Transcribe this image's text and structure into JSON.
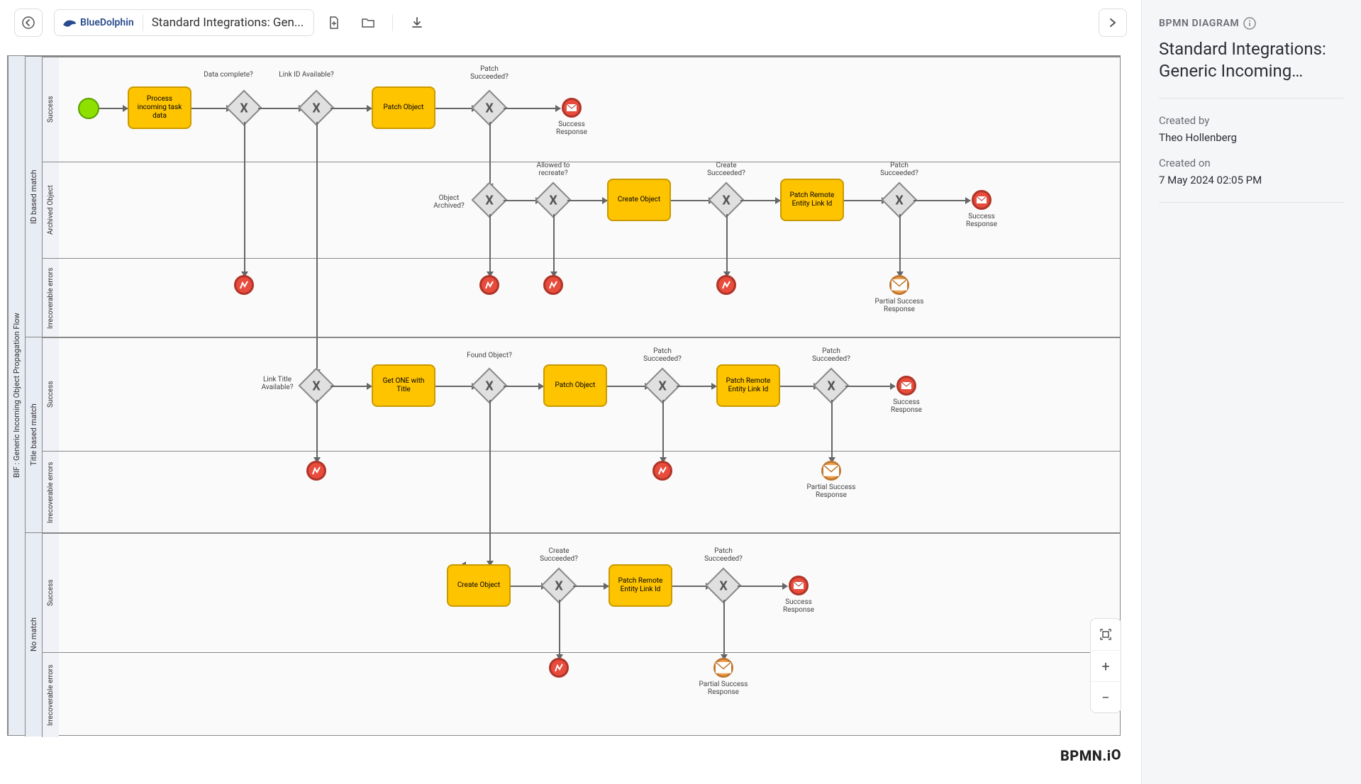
{
  "toolbar": {
    "brand": "BlueDolphin",
    "title": "Standard Integrations: Gen...",
    "icons": {
      "back": "back",
      "add_doc": "add-doc",
      "folder": "folder",
      "download": "download",
      "next": "next"
    }
  },
  "sidebar": {
    "heading": "BPMN DIAGRAM",
    "title": "Standard Integrations: Generic Incoming…",
    "created_by_label": "Created by",
    "created_by": "Theo Hollenberg",
    "created_on_label": "Created on",
    "created_on": "7 May 2024 02:05 PM"
  },
  "watermark": "BPMN.iO",
  "pool": {
    "name": "BIF : Generic Incoming Object Propagation Flow",
    "lanes": [
      {
        "name": "ID based match",
        "sublanes": [
          {
            "name": "Success"
          },
          {
            "name": "Archived Object"
          },
          {
            "name": "Irrecoverable errors"
          }
        ]
      },
      {
        "name": "Title based match",
        "sublanes": [
          {
            "name": "Success"
          },
          {
            "name": "Irrecoverable errors"
          }
        ]
      },
      {
        "name": "No match",
        "sublanes": [
          {
            "name": "Success"
          },
          {
            "name": "Irrecoverable errors"
          }
        ]
      }
    ]
  },
  "bpmn": {
    "tasks": {
      "process_incoming": "Process incoming task data",
      "patch_object": "Patch Object",
      "create_object": "Create Object",
      "patch_remote": "Patch Remote Entity Link Id",
      "get_one_title": "Get ONE with Title",
      "patch_object2": "Patch Object",
      "patch_remote2": "Patch Remote Entity Link Id",
      "create_object2": "Create Object",
      "patch_remote3": "Patch Remote Entity Link Id"
    },
    "gateways": {
      "data_complete": "Data complete?",
      "link_id_avail": "Link ID Available?",
      "patch_succeeded1": "Patch Succeeded?",
      "object_archived": "Object Archived?",
      "allowed_recreate": "Allowed to recreate?",
      "create_succeeded1": "Create Succeeded?",
      "patch_succeeded2": "Patch Succeeded?",
      "link_title_avail": "Link Title Available?",
      "found_object": "Found Object?",
      "patch_succeeded3": "Patch Succeeded?",
      "patch_succeeded4": "Patch Succeeded?",
      "create_succeeded2": "Create Succeeded?",
      "patch_succeeded5": "Patch Succeeded?"
    },
    "events": {
      "success_response": "Success Response",
      "partial_success": "Partial Success Response"
    }
  },
  "zoom": {
    "fit": "fit",
    "in": "+",
    "out": "−"
  }
}
